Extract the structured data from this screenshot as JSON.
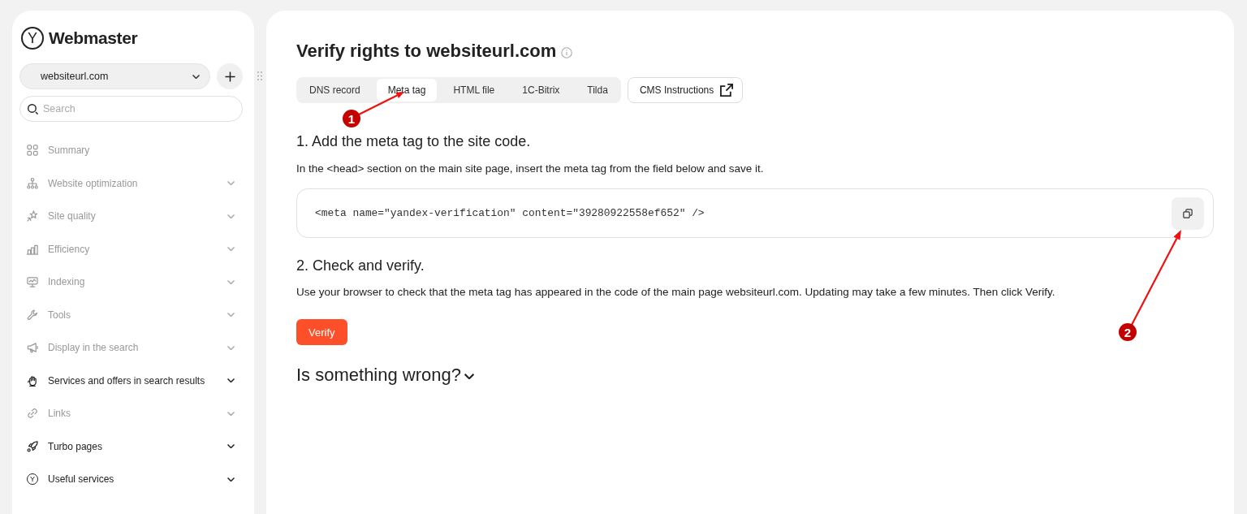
{
  "sidebar": {
    "logo": {
      "mark": "Y",
      "text": "Webmaster"
    },
    "site_selector": {
      "value": "websiteurl.com"
    },
    "search": {
      "placeholder": "Search"
    },
    "items": [
      {
        "label": "Summary",
        "kind": "link",
        "disabled": true
      },
      {
        "label": "Website optimization",
        "kind": "group",
        "disabled": true
      },
      {
        "label": "Site quality",
        "kind": "group",
        "disabled": true
      },
      {
        "label": "Efficiency",
        "kind": "group",
        "disabled": true
      },
      {
        "label": "Indexing",
        "kind": "group",
        "disabled": true
      },
      {
        "label": "Tools",
        "kind": "group",
        "disabled": true
      },
      {
        "label": "Display in the search",
        "kind": "group",
        "disabled": true
      },
      {
        "label": "Services and offers in search results",
        "kind": "group",
        "disabled": false
      },
      {
        "label": "Links",
        "kind": "group",
        "disabled": true
      },
      {
        "label": "Turbo pages",
        "kind": "group",
        "disabled": false
      },
      {
        "label": "Useful services",
        "kind": "group",
        "disabled": false,
        "icon_text": "Y"
      }
    ]
  },
  "main": {
    "title": "Verify rights to websiteurl.com",
    "tabs": [
      {
        "label": "DNS record",
        "selected": false
      },
      {
        "label": "Meta tag",
        "selected": true
      },
      {
        "label": "HTML file",
        "selected": false
      },
      {
        "label": "1C-Bitrix",
        "selected": false
      },
      {
        "label": "Tilda",
        "selected": false
      }
    ],
    "cms_button": {
      "label": "CMS Instructions"
    },
    "steps": [
      {
        "heading": "1. Add the meta tag to the site code.",
        "text": "In the <head> section on the main site page, insert the meta tag from the field below and save it.",
        "code": "<meta name=\"yandex-verification\" content=\"39280922558ef652\" />"
      },
      {
        "heading": "2. Check and verify.",
        "text": "Use your browser to check that the meta tag has appeared in the code of the main page websiteurl.com. Updating may take a few minutes. Then click Verify.",
        "button": "Verify"
      }
    ],
    "trouble": {
      "label": "Is something wrong?",
      "expanded": false
    }
  },
  "annotations": [
    {
      "label": "1"
    },
    {
      "label": "2"
    }
  ]
}
